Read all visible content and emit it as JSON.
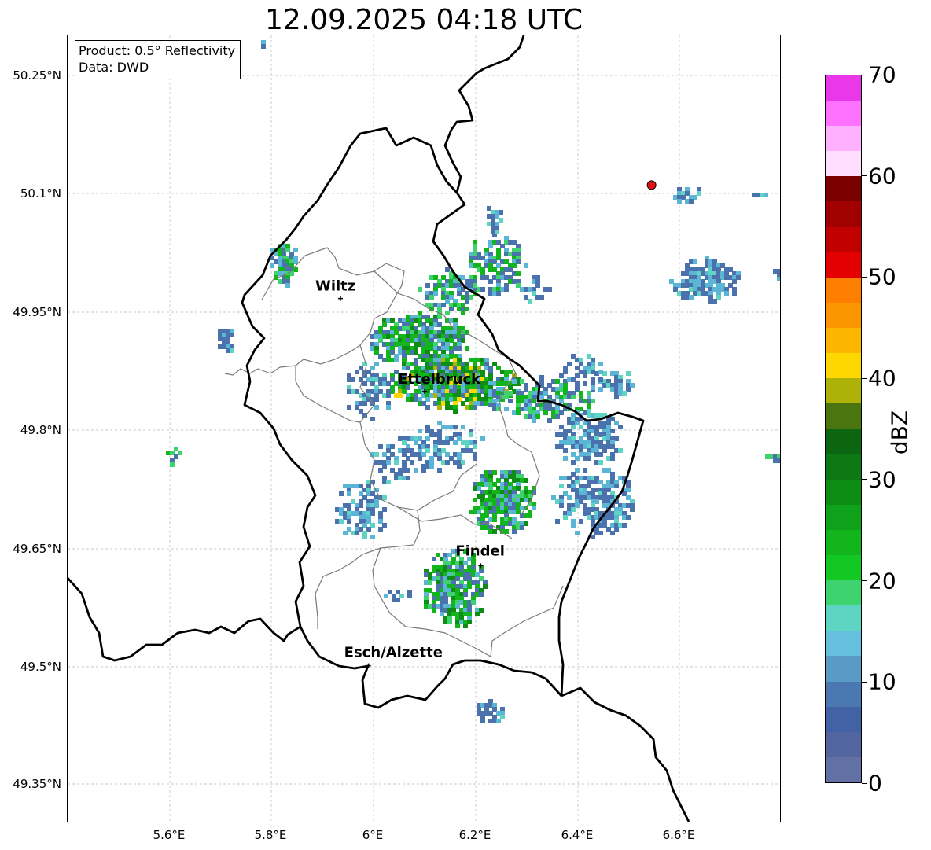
{
  "title": "12.09.2025 04:18 UTC",
  "info_box": {
    "product": "Product: 0.5° Reflectivity",
    "data_source": "Data: DWD"
  },
  "axes": {
    "lat_ticks": [
      "50.25°N",
      "50.1°N",
      "49.95°N",
      "49.8°N",
      "49.65°N",
      "49.5°N",
      "49.35°N"
    ],
    "lon_ticks": [
      "5.6°E",
      "5.8°E",
      "6°E",
      "6.2°E",
      "6.4°E",
      "6.6°E"
    ]
  },
  "cities": [
    {
      "name": "Wiltz",
      "lon": 5.935,
      "lat": 49.966
    },
    {
      "name": "Ettelbruck",
      "lon": 6.1,
      "lat": 49.848
    },
    {
      "name": "Findel",
      "lon": 6.21,
      "lat": 49.627
    },
    {
      "name": "Esch/Alzette",
      "lon": 5.99,
      "lat": 49.5
    }
  ],
  "colorbar": {
    "label": "dBZ",
    "ticks": [
      "0",
      "10",
      "20",
      "30",
      "40",
      "50",
      "60",
      "70"
    ],
    "colors": [
      "#6270a6",
      "#52659e",
      "#4361a5",
      "#4b78b0",
      "#5a9bc5",
      "#66bfdf",
      "#5ed5c2",
      "#3fd36f",
      "#13c823",
      "#12b51b",
      "#0fa11a",
      "#0d8d14",
      "#0d7914",
      "#0b6511",
      "#4b760f",
      "#aeb108",
      "#fed600",
      "#fdb600",
      "#fc9600",
      "#fe7e00",
      "#e20000",
      "#c10000",
      "#a00000",
      "#7a0000",
      "#ffdeff",
      "#ffb1ff",
      "#ff71ff",
      "#ea37ea"
    ]
  },
  "map_extent": {
    "lon_min": 5.4,
    "lon_max": 6.8,
    "lat_min": 49.3,
    "lat_max": 50.3
  },
  "radar_site_marker": {
    "lon": 6.545,
    "lat": 50.11,
    "color": "#e01010"
  },
  "precip_colors": {
    "blue": "#4c72ad",
    "lightblue": "#5bb6d6",
    "cyan": "#5ed5c2",
    "lightgreen": "#3fd36f",
    "green": "#12b51b",
    "darkgreen": "#0d8d14",
    "yellow": "#fed600",
    "olive": "#aeb108"
  }
}
